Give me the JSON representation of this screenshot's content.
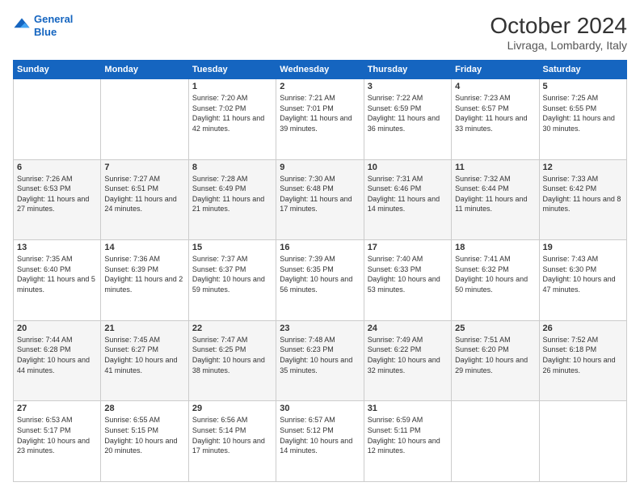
{
  "header": {
    "logo_line1": "General",
    "logo_line2": "Blue",
    "title": "October 2024",
    "subtitle": "Livraga, Lombardy, Italy"
  },
  "weekdays": [
    "Sunday",
    "Monday",
    "Tuesday",
    "Wednesday",
    "Thursday",
    "Friday",
    "Saturday"
  ],
  "weeks": [
    [
      null,
      null,
      {
        "day": "1",
        "sunrise": "7:20 AM",
        "sunset": "7:02 PM",
        "daylight": "11 hours and 42 minutes."
      },
      {
        "day": "2",
        "sunrise": "7:21 AM",
        "sunset": "7:01 PM",
        "daylight": "11 hours and 39 minutes."
      },
      {
        "day": "3",
        "sunrise": "7:22 AM",
        "sunset": "6:59 PM",
        "daylight": "11 hours and 36 minutes."
      },
      {
        "day": "4",
        "sunrise": "7:23 AM",
        "sunset": "6:57 PM",
        "daylight": "11 hours and 33 minutes."
      },
      {
        "day": "5",
        "sunrise": "7:25 AM",
        "sunset": "6:55 PM",
        "daylight": "11 hours and 30 minutes."
      }
    ],
    [
      {
        "day": "6",
        "sunrise": "7:26 AM",
        "sunset": "6:53 PM",
        "daylight": "11 hours and 27 minutes."
      },
      {
        "day": "7",
        "sunrise": "7:27 AM",
        "sunset": "6:51 PM",
        "daylight": "11 hours and 24 minutes."
      },
      {
        "day": "8",
        "sunrise": "7:28 AM",
        "sunset": "6:49 PM",
        "daylight": "11 hours and 21 minutes."
      },
      {
        "day": "9",
        "sunrise": "7:30 AM",
        "sunset": "6:48 PM",
        "daylight": "11 hours and 17 minutes."
      },
      {
        "day": "10",
        "sunrise": "7:31 AM",
        "sunset": "6:46 PM",
        "daylight": "11 hours and 14 minutes."
      },
      {
        "day": "11",
        "sunrise": "7:32 AM",
        "sunset": "6:44 PM",
        "daylight": "11 hours and 11 minutes."
      },
      {
        "day": "12",
        "sunrise": "7:33 AM",
        "sunset": "6:42 PM",
        "daylight": "11 hours and 8 minutes."
      }
    ],
    [
      {
        "day": "13",
        "sunrise": "7:35 AM",
        "sunset": "6:40 PM",
        "daylight": "11 hours and 5 minutes."
      },
      {
        "day": "14",
        "sunrise": "7:36 AM",
        "sunset": "6:39 PM",
        "daylight": "11 hours and 2 minutes."
      },
      {
        "day": "15",
        "sunrise": "7:37 AM",
        "sunset": "6:37 PM",
        "daylight": "10 hours and 59 minutes."
      },
      {
        "day": "16",
        "sunrise": "7:39 AM",
        "sunset": "6:35 PM",
        "daylight": "10 hours and 56 minutes."
      },
      {
        "day": "17",
        "sunrise": "7:40 AM",
        "sunset": "6:33 PM",
        "daylight": "10 hours and 53 minutes."
      },
      {
        "day": "18",
        "sunrise": "7:41 AM",
        "sunset": "6:32 PM",
        "daylight": "10 hours and 50 minutes."
      },
      {
        "day": "19",
        "sunrise": "7:43 AM",
        "sunset": "6:30 PM",
        "daylight": "10 hours and 47 minutes."
      }
    ],
    [
      {
        "day": "20",
        "sunrise": "7:44 AM",
        "sunset": "6:28 PM",
        "daylight": "10 hours and 44 minutes."
      },
      {
        "day": "21",
        "sunrise": "7:45 AM",
        "sunset": "6:27 PM",
        "daylight": "10 hours and 41 minutes."
      },
      {
        "day": "22",
        "sunrise": "7:47 AM",
        "sunset": "6:25 PM",
        "daylight": "10 hours and 38 minutes."
      },
      {
        "day": "23",
        "sunrise": "7:48 AM",
        "sunset": "6:23 PM",
        "daylight": "10 hours and 35 minutes."
      },
      {
        "day": "24",
        "sunrise": "7:49 AM",
        "sunset": "6:22 PM",
        "daylight": "10 hours and 32 minutes."
      },
      {
        "day": "25",
        "sunrise": "7:51 AM",
        "sunset": "6:20 PM",
        "daylight": "10 hours and 29 minutes."
      },
      {
        "day": "26",
        "sunrise": "7:52 AM",
        "sunset": "6:18 PM",
        "daylight": "10 hours and 26 minutes."
      }
    ],
    [
      {
        "day": "27",
        "sunrise": "6:53 AM",
        "sunset": "5:17 PM",
        "daylight": "10 hours and 23 minutes."
      },
      {
        "day": "28",
        "sunrise": "6:55 AM",
        "sunset": "5:15 PM",
        "daylight": "10 hours and 20 minutes."
      },
      {
        "day": "29",
        "sunrise": "6:56 AM",
        "sunset": "5:14 PM",
        "daylight": "10 hours and 17 minutes."
      },
      {
        "day": "30",
        "sunrise": "6:57 AM",
        "sunset": "5:12 PM",
        "daylight": "10 hours and 14 minutes."
      },
      {
        "day": "31",
        "sunrise": "6:59 AM",
        "sunset": "5:11 PM",
        "daylight": "10 hours and 12 minutes."
      },
      null,
      null
    ]
  ]
}
